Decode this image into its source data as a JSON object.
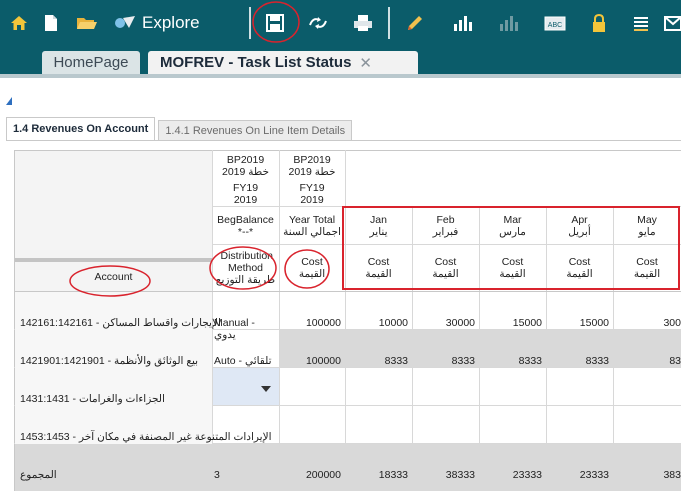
{
  "toolbar": {
    "explore_label": "Explore",
    "icons": [
      "home-icon",
      "document-icon",
      "folder-open-icon",
      "explore-icon",
      "save-icon",
      "refresh-icon",
      "print-icon",
      "edit-pencil-icon",
      "chart-icon",
      "chart-disabled-icon",
      "spell-check-icon",
      "lock-icon",
      "list-icon",
      "more-icon"
    ]
  },
  "tabs": {
    "home": "HomePage",
    "active": "MOFREV - Task List Status",
    "close": "✕"
  },
  "sheet_tabs": {
    "active": "1.4 Revenues On Account",
    "inactive": "1.4.1 Revenues On Line Item Details"
  },
  "grid": {
    "row_header": "Account",
    "columns": [
      {
        "scenario": "BP2019",
        "scenario_ar": "خطة 2019",
        "year": "FY19",
        "year2": "2019",
        "period": "BegBalance",
        "period_ar": "*--*",
        "measure": "Distribution Method",
        "measure_ar": "طريقة التوزيع"
      },
      {
        "scenario": "BP2019",
        "scenario_ar": "خطة 2019",
        "year": "FY19",
        "year2": "2019",
        "period": "Year Total",
        "period_ar": "اجمالي السنة",
        "measure": "Cost",
        "measure_ar": "القيمة"
      },
      {
        "period": "Jan",
        "period_ar": "يناير",
        "measure": "Cost",
        "measure_ar": "القيمة"
      },
      {
        "period": "Feb",
        "period_ar": "فبراير",
        "measure": "Cost",
        "measure_ar": "القيمة"
      },
      {
        "period": "Mar",
        "period_ar": "مارس",
        "measure": "Cost",
        "measure_ar": "القيمة"
      },
      {
        "period": "Apr",
        "period_ar": "أبريل",
        "measure": "Cost",
        "measure_ar": "القيمة"
      },
      {
        "period": "May",
        "period_ar": "مايو",
        "measure": "Cost",
        "measure_ar": "القيمة"
      }
    ],
    "rows": [
      {
        "label": "الإيجارات واقساط المساكن - 142161:142161",
        "method": "Manual - يدوي",
        "total": "100000",
        "months": [
          "10000",
          "30000",
          "15000",
          "15000",
          "300"
        ]
      },
      {
        "label": "بيع الوثائق والأنظمة - 1421901:1421901",
        "method": "Auto - تلقائي",
        "total": "100000",
        "months": [
          "8333",
          "8333",
          "8333",
          "8333",
          "83"
        ]
      },
      {
        "label": "الجزاءات والغرامات - 1431:1431",
        "method": "",
        "total": "",
        "months": [
          "",
          "",
          "",
          "",
          ""
        ]
      },
      {
        "label": "الإيرادات المتنوعة غير المصنفة في مكان آخر - 1453:1453",
        "method": "",
        "total": "",
        "months": [
          "",
          "",
          "",
          "",
          ""
        ]
      },
      {
        "label": "المجموع",
        "method": "3",
        "total": "200000",
        "months": [
          "18333",
          "38333",
          "23333",
          "23333",
          "383"
        ]
      }
    ]
  },
  "colors": {
    "toolbar_bg": "#0b5c6a",
    "annotation_red": "#d9232d",
    "readonly_gray": "#d9d9d9",
    "selected_blue": "#dfe8f5"
  }
}
